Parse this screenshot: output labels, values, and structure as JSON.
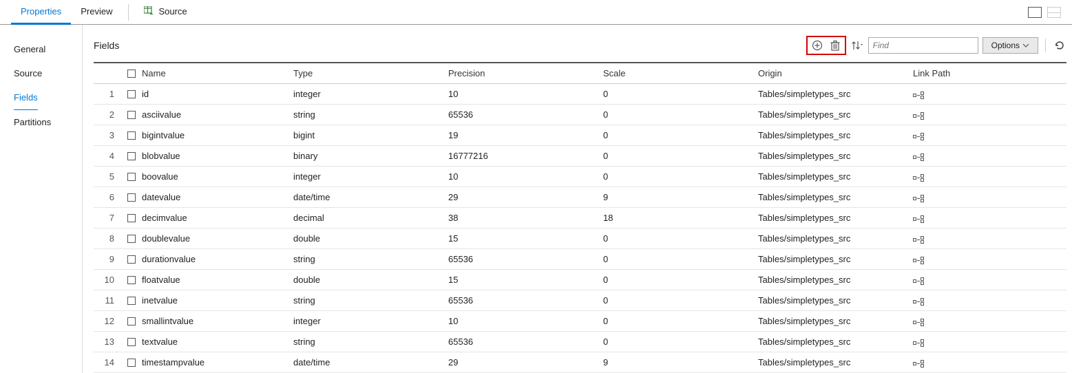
{
  "topTabs": {
    "properties": "Properties",
    "preview": "Preview",
    "source": "Source"
  },
  "sideTabs": {
    "general": "General",
    "source": "Source",
    "fields": "Fields",
    "partitions": "Partitions"
  },
  "panel": {
    "title": "Fields",
    "findPlaceholder": "Find",
    "optionsLabel": "Options"
  },
  "columns": {
    "name": "Name",
    "type": "Type",
    "precision": "Precision",
    "scale": "Scale",
    "origin": "Origin",
    "linkPath": "Link Path"
  },
  "rows": [
    {
      "n": "1",
      "name": "id",
      "type": "integer",
      "precision": "10",
      "scale": "0",
      "origin": "Tables/simpletypes_src"
    },
    {
      "n": "2",
      "name": "asciivalue",
      "type": "string",
      "precision": "65536",
      "scale": "0",
      "origin": "Tables/simpletypes_src"
    },
    {
      "n": "3",
      "name": "bigintvalue",
      "type": "bigint",
      "precision": "19",
      "scale": "0",
      "origin": "Tables/simpletypes_src"
    },
    {
      "n": "4",
      "name": "blobvalue",
      "type": "binary",
      "precision": "16777216",
      "scale": "0",
      "origin": "Tables/simpletypes_src"
    },
    {
      "n": "5",
      "name": "boovalue",
      "type": "integer",
      "precision": "10",
      "scale": "0",
      "origin": "Tables/simpletypes_src"
    },
    {
      "n": "6",
      "name": "datevalue",
      "type": "date/time",
      "precision": "29",
      "scale": "9",
      "origin": "Tables/simpletypes_src"
    },
    {
      "n": "7",
      "name": "decimvalue",
      "type": "decimal",
      "precision": "38",
      "scale": "18",
      "origin": "Tables/simpletypes_src"
    },
    {
      "n": "8",
      "name": "doublevalue",
      "type": "double",
      "precision": "15",
      "scale": "0",
      "origin": "Tables/simpletypes_src"
    },
    {
      "n": "9",
      "name": "durationvalue",
      "type": "string",
      "precision": "65536",
      "scale": "0",
      "origin": "Tables/simpletypes_src"
    },
    {
      "n": "10",
      "name": "floatvalue",
      "type": "double",
      "precision": "15",
      "scale": "0",
      "origin": "Tables/simpletypes_src"
    },
    {
      "n": "11",
      "name": "inetvalue",
      "type": "string",
      "precision": "65536",
      "scale": "0",
      "origin": "Tables/simpletypes_src"
    },
    {
      "n": "12",
      "name": "smallintvalue",
      "type": "integer",
      "precision": "10",
      "scale": "0",
      "origin": "Tables/simpletypes_src"
    },
    {
      "n": "13",
      "name": "textvalue",
      "type": "string",
      "precision": "65536",
      "scale": "0",
      "origin": "Tables/simpletypes_src"
    },
    {
      "n": "14",
      "name": "timestampvalue",
      "type": "date/time",
      "precision": "29",
      "scale": "9",
      "origin": "Tables/simpletypes_src"
    }
  ]
}
